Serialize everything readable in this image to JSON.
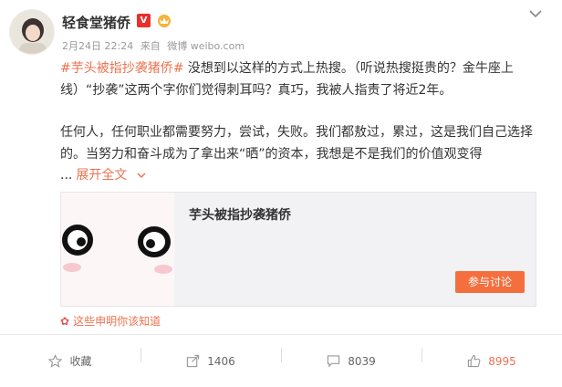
{
  "post": {
    "author": "轻食堂猪侨",
    "verified_badge": "V",
    "date": "2月24日 22:24",
    "source_prefix": "来自",
    "source": "微博 weibo.com",
    "topic": "#芋头被指抄袭猪侨#",
    "para1_rest": " 没想到以这样的方式上热搜。（听说热搜挺贵的？金牛座上线）“抄袭”这两个字你们觉得刺耳吗？真巧，我被人指责了将近2年。",
    "para2": "任何人，任何职业都需要努力，尝试，失败。我们都敖过，累过，这是我们自己选择的。当努力和奋斗成为了拿出来“晒”的资本，我想是不是我们的价值观变得",
    "ellipsis": "...",
    "expand_label": "展开全文",
    "expand_icon": "chevron-down-icon"
  },
  "link_card": {
    "title": "芋头被指抄袭猪侨",
    "button_label": "参与讨论"
  },
  "notice": {
    "icon": "flower-icon",
    "text": "这些申明你该知道"
  },
  "actions": [
    {
      "icon": "star-icon",
      "label": "收藏"
    },
    {
      "icon": "share-icon",
      "label": "1406"
    },
    {
      "icon": "comment-icon",
      "label": "8039"
    },
    {
      "icon": "thumbs-up-icon",
      "label": "8995"
    }
  ],
  "colors": {
    "accent": "#eb7350",
    "button": "#f56f3e",
    "verified": "#e8302c"
  }
}
